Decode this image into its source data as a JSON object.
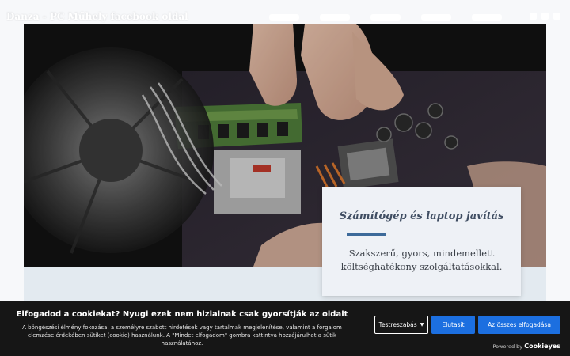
{
  "header": {
    "site_title": "Danza - PC Műhely facebook oldal"
  },
  "hero": {
    "card_title": "Számítógép és laptop javítás",
    "card_text": "Szakszerű, gyors, mindemellett költséghatékony szolgáltatásokkal."
  },
  "cookie_banner": {
    "title": "Elfogadod a cookiekat? Nyugi ezek nem hizlalnak csak gyorsítják az oldalt",
    "text": "A böngészési élmény fokozása, a személyre szabott hirdetések vagy tartalmak megjelenítése, valamint a forgalom elemzése érdekében sütiket (cookie) használunk. A \"Mindet elfogadom\" gombra kattintva hozzájárulhat a sütik használatához.",
    "customize_label": "Testreszabás",
    "reject_label": "Elutasít",
    "accept_label": "Az összes elfogadása",
    "powered_label": "Powered by",
    "powered_brand": "Cookieyes"
  },
  "colors": {
    "accent": "#1c6fe0",
    "card_divider": "#3d6a9a",
    "banner_bg": "#161616"
  }
}
